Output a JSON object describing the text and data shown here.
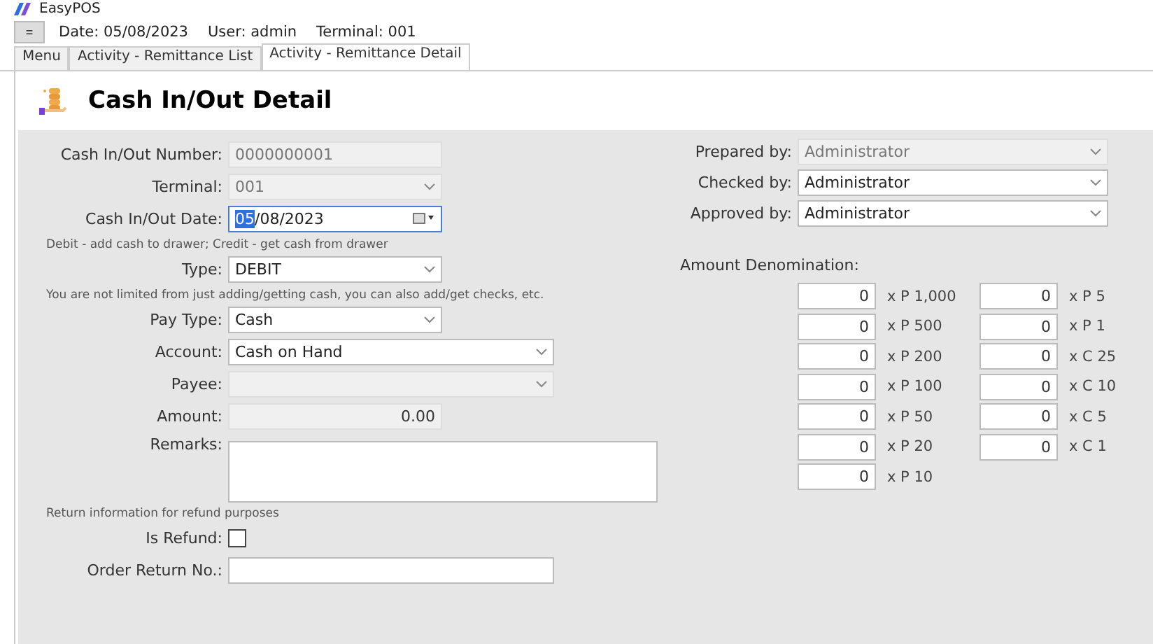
{
  "window": {
    "title": "EasyPOS"
  },
  "toolbar": {
    "menu_button": "=",
    "date": "Date: 05/08/2023",
    "user": "User: admin",
    "terminal": "Terminal: 001"
  },
  "tabs": [
    {
      "label": "Menu",
      "selected": false
    },
    {
      "label": "Activity - Remittance List",
      "selected": false
    },
    {
      "label": "Activity - Remittance Detail",
      "selected": true
    }
  ],
  "page": {
    "title": "Cash In/Out Detail"
  },
  "left_fields": [
    {
      "kind": "readonly",
      "label": "Cash In/Out Number:",
      "value": "0000000001"
    },
    {
      "kind": "combo",
      "label": "Terminal:",
      "value": "001",
      "disabled": true
    },
    {
      "kind": "date",
      "label": "Cash In/Out Date:",
      "selected_part": "05",
      "value": "/08/2023"
    },
    {
      "kind": "hint",
      "text": "Debit - add cash to drawer; Credit - get cash from drawer"
    },
    {
      "kind": "combo",
      "label": "Type:",
      "value": "DEBIT",
      "disabled": false
    },
    {
      "kind": "hint",
      "text": "You are not limited from just adding/getting cash, you can also add/get checks, etc."
    },
    {
      "kind": "combo",
      "label": "Pay Type:",
      "value": "Cash",
      "disabled": false
    },
    {
      "kind": "lookup",
      "label": "Account:",
      "value": "Cash on Hand",
      "disabled": false
    },
    {
      "kind": "lookup",
      "label": "Payee:",
      "disabled": true
    },
    {
      "kind": "amount",
      "label": "Amount:",
      "value": "0.00"
    },
    {
      "kind": "memo",
      "label": "Remarks:"
    },
    {
      "kind": "hint",
      "text": "Return information for refund purposes"
    },
    {
      "kind": "checkbox",
      "label": "Is Refund:",
      "checked": false
    },
    {
      "kind": "entry",
      "label": "Order Return No.:"
    }
  ],
  "right_fields": [
    {
      "label": "Prepared by:",
      "value": "Administrator",
      "disabled": true
    },
    {
      "label": "Checked by:",
      "value": "Administrator",
      "disabled": false
    },
    {
      "label": "Approved by:",
      "value": "Administrator",
      "disabled": false
    }
  ],
  "denomination": {
    "title": "Amount Denomination:",
    "columns": [
      [
        {
          "count": "0",
          "label": "x P 1,000"
        },
        {
          "count": "0",
          "label": "x P 500"
        },
        {
          "count": "0",
          "label": "x P 200"
        },
        {
          "count": "0",
          "label": "x P 100"
        },
        {
          "count": "0",
          "label": "x P 50"
        },
        {
          "count": "0",
          "label": "x P 20"
        },
        {
          "count": "0",
          "label": "x P 10"
        }
      ],
      [
        {
          "count": "0",
          "label": "x P 5"
        },
        {
          "count": "0",
          "label": "x P 1"
        },
        {
          "count": "0",
          "label": "x C 25"
        },
        {
          "count": "0",
          "label": "x C 10"
        },
        {
          "count": "0",
          "label": "x C 5"
        },
        {
          "count": "0",
          "label": "x C 1"
        }
      ]
    ]
  }
}
